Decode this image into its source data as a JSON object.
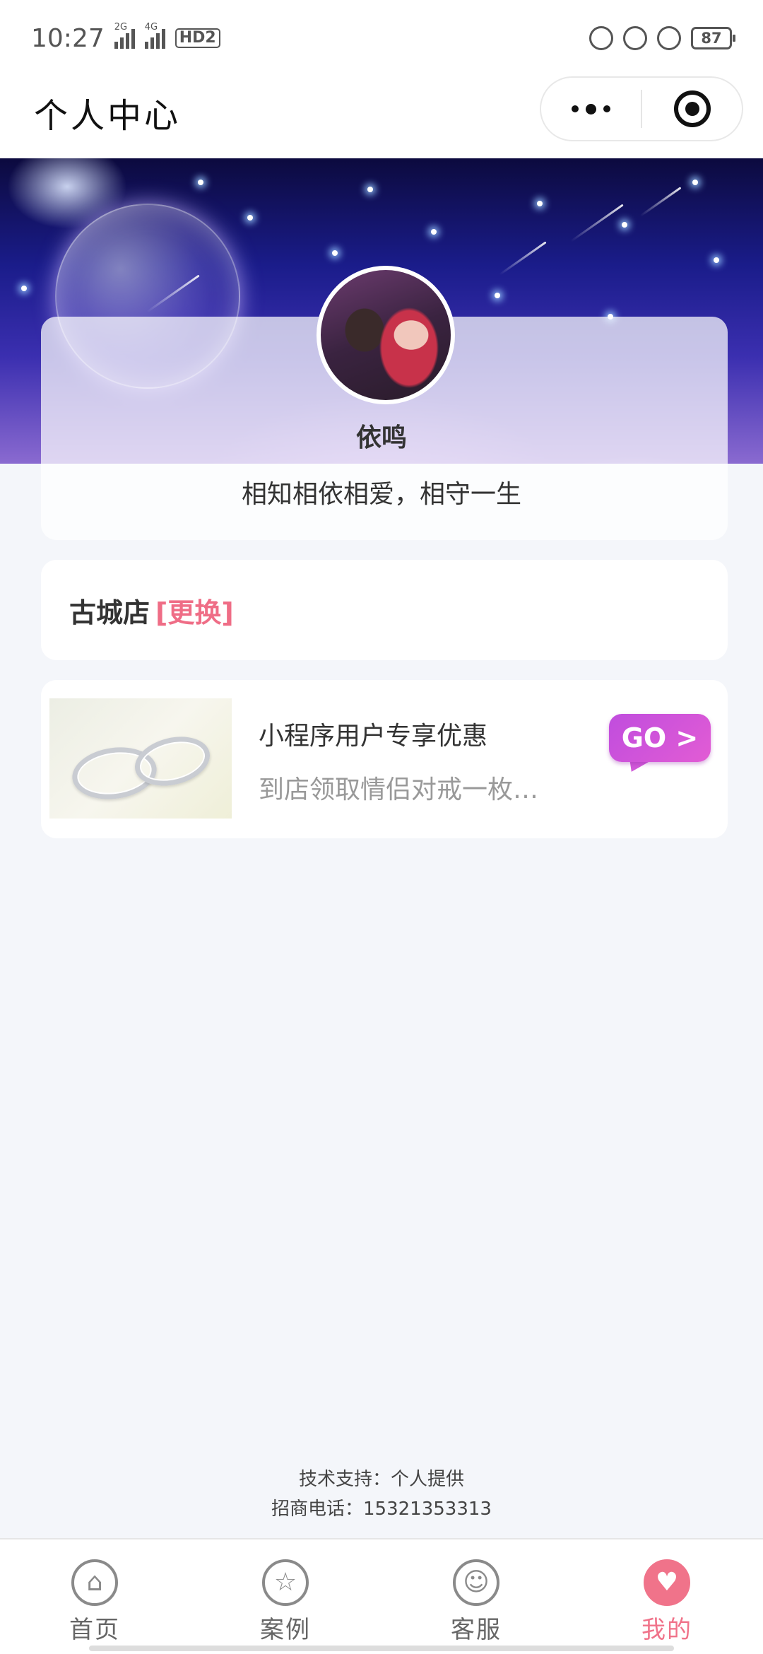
{
  "status_bar": {
    "time": "10:27",
    "signal_1": "2G",
    "signal_2": "4G",
    "hd": "HD2",
    "battery": "87"
  },
  "header": {
    "title": "个人中心",
    "icons": [
      "more-dots-icon",
      "target-icon"
    ]
  },
  "profile": {
    "username": "依鸣",
    "signature": "相知相依相爱，相守一生"
  },
  "store": {
    "name": "古城店",
    "change_label": "[更换]"
  },
  "promo": {
    "title": "小程序用户专享优惠",
    "subtitle": "到店领取情侣对戒一枚…",
    "go_label": "GO >"
  },
  "footer": {
    "support": "技术支持：个人提供",
    "phone": "招商电话：15321353313"
  },
  "tabs": [
    {
      "label": "首页",
      "icon": "home-icon"
    },
    {
      "label": "案例",
      "icon": "star-icon"
    },
    {
      "label": "客服",
      "icon": "customer-service-icon"
    },
    {
      "label": "我的",
      "icon": "heart-icon",
      "active": true
    }
  ],
  "colors": {
    "accent": "#f0738a",
    "change": "#ef6d86",
    "go_button": "#d058d8"
  }
}
